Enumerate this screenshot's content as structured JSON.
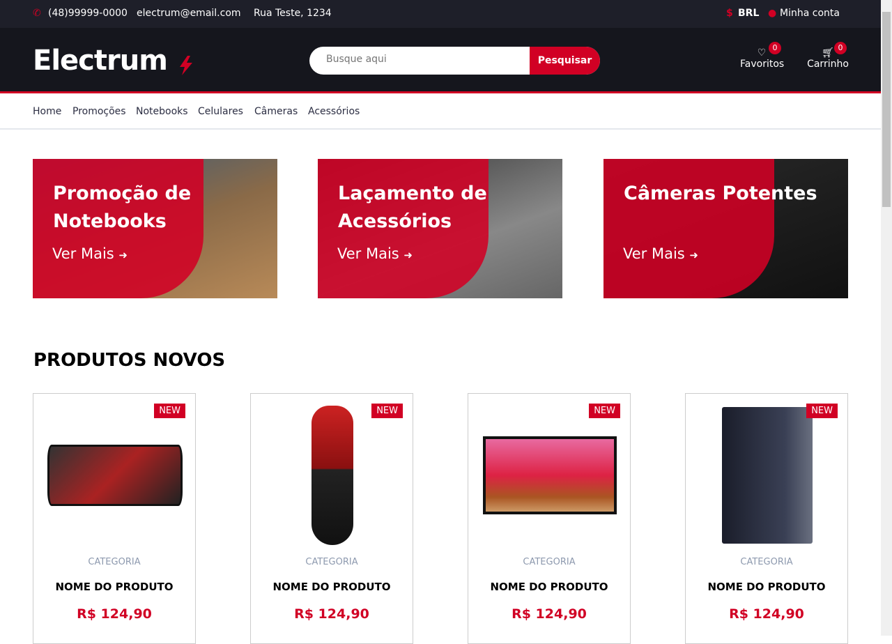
{
  "topbar": {
    "phone": "(48)99999-0000",
    "email": "electrum@email.com",
    "address": "Rua Teste, 1234",
    "currency": "BRL",
    "account": "Minha conta"
  },
  "header": {
    "logo": "Electrum",
    "search_placeholder": "Busque aqui",
    "search_button": "Pesquisar",
    "favorites_label": "Favoritos",
    "favorites_count": "0",
    "cart_label": "Carrinho",
    "cart_count": "0"
  },
  "nav": [
    "Home",
    "Promoções",
    "Notebooks",
    "Celulares",
    "Câmeras",
    "Acessórios"
  ],
  "banners": [
    {
      "title": "Promoção de Notebooks",
      "link": "Ver Mais"
    },
    {
      "title": "Laçamento de Acessórios",
      "link": "Ver Mais"
    },
    {
      "title": "Câmeras Potentes",
      "link": "Ver Mais"
    }
  ],
  "section_title": "PRODUTOS NOVOS",
  "products": [
    {
      "badge": "NEW",
      "category": "CATEGORIA",
      "name": "NOME DO PRODUTO",
      "price": "R$ 124,90"
    },
    {
      "badge": "NEW",
      "category": "CATEGORIA",
      "name": "NOME DO PRODUTO",
      "price": "R$ 124,90"
    },
    {
      "badge": "NEW",
      "category": "CATEGORIA",
      "name": "NOME DO PRODUTO",
      "price": "R$ 124,90"
    },
    {
      "badge": "NEW",
      "category": "CATEGORIA",
      "name": "NOME DO PRODUTO",
      "price": "R$ 124,90"
    }
  ],
  "colors": {
    "accent": "#d10024",
    "topbar": "#1e1f29",
    "header": "#15161d"
  }
}
